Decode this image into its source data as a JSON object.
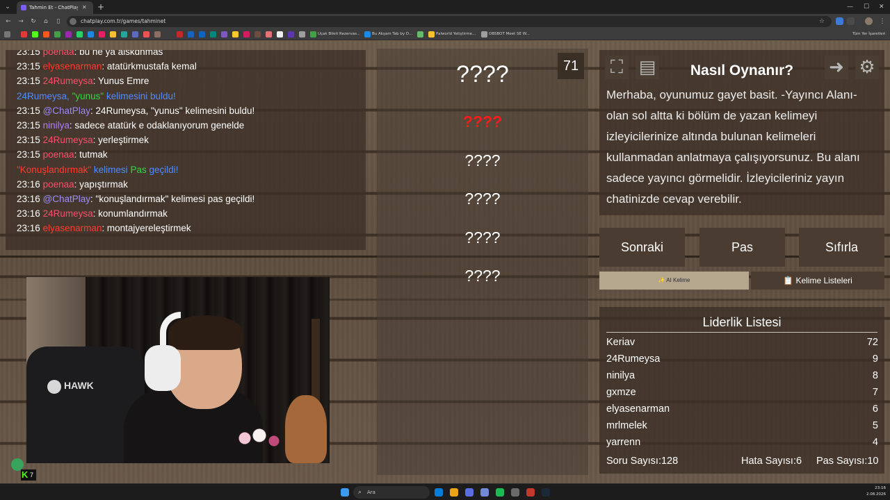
{
  "browser": {
    "tab_title": "Tahmin Et - ChatPlay",
    "url": "chatplay.com.tr/games/tahminet",
    "bookmarks": [
      "Uçak Bileti Rezervas...",
      "Bu Akşam Tab by D...",
      "Palworld Yetiştirme...",
      "OBSBOT Meet SE W..."
    ],
    "all_bookmarks_label": "Tüm Yer İşaretleri"
  },
  "chat": {
    "lines": [
      {
        "time": "23:15",
        "user": "poenaa",
        "color": "pink",
        "text": ": bu ne ya alskdnmas"
      },
      {
        "time": "23:15",
        "user": "elyasenarman",
        "color": "red",
        "text": ": atatürkmustafa kemal"
      },
      {
        "time": "23:15",
        "user": "24Rumeysa",
        "color": "pink",
        "text": ": Yunus Emre"
      },
      {
        "time": "23:15",
        "user": "@ChatPlay",
        "color": "violet",
        "text": ": 24Rumeysa, \"yunus\" kelimesini buldu!"
      },
      {
        "time": "23:15",
        "user": "ninilya",
        "color": "purple",
        "text": ": sadece atatürk e odaklanıyorum genelde"
      },
      {
        "time": "23:15",
        "user": "24Rumeysa",
        "color": "pink",
        "text": ": yerleştirmek"
      },
      {
        "time": "23:15",
        "user": "poenaa",
        "color": "pink",
        "text": ": tutmak"
      },
      {
        "time": "23:16",
        "user": "poenaa",
        "color": "pink",
        "text": ": yapıştırmak"
      },
      {
        "time": "23:16",
        "user": "@ChatPlay",
        "color": "violet",
        "text": ": \"konuşlandırmak\" kelimesi pas geçildi!"
      },
      {
        "time": "23:16",
        "user": "24Rumeysa",
        "color": "pink",
        "text": ": konumlandırmak"
      },
      {
        "time": "23:16",
        "user": "elyasenarman",
        "color": "red",
        "text": ": montajyereleştirmek"
      }
    ],
    "found_notice": {
      "user": "24Rumeysa",
      "word": "\"yunus\"",
      "rest": "kelimesini buldu!"
    },
    "pass_notice": {
      "word": "\"Konuşlandırmak\"",
      "mid": "kelimesi",
      "pas": "Pas",
      "end": "geçildi!"
    }
  },
  "stream": {
    "badge_text": "7"
  },
  "words": {
    "counter": "71",
    "main": "????",
    "highlighted": "????",
    "list": [
      "????",
      "????",
      "????",
      "????"
    ]
  },
  "info": {
    "title": "Nasıl Oynanır?",
    "text": "Merhaba, oyunumuz gayet basit. -Yayıncı Alanı- olan sol altta ki bölüm de yazan kelimeyi izleyicilerinize altında bulunan kelimeleri kullanmadan anlatmaya çalışıyorsunuz. Bu alanı sadece yayıncı görmelidir. İzleyicileriniz yayın chatinizde cevap verebilir."
  },
  "actions": {
    "next": "Sonraki",
    "pass": "Pas",
    "reset": "Sıfırla",
    "ai_word_tab": "✨ AI Kelime",
    "word_lists_tab": "📋 Kelime Listeleri"
  },
  "leaderboard": {
    "title": "Liderlik Listesi",
    "rows": [
      {
        "name": "Keriav",
        "score": "72"
      },
      {
        "name": "24Rumeysa",
        "score": "9"
      },
      {
        "name": "ninilya",
        "score": "8"
      },
      {
        "name": "gxmze",
        "score": "7"
      },
      {
        "name": "elyasenarman",
        "score": "6"
      },
      {
        "name": "mrlmelek",
        "score": "5"
      },
      {
        "name": "yarrenn",
        "score": "4"
      }
    ],
    "question_label": "Soru Sayısı:",
    "question_count": "128",
    "error_label": "Hata Sayısı:",
    "error_count": "6",
    "pass_label": "Pas Sayısı:",
    "pass_count": "10"
  },
  "taskbar": {
    "search_label": "Ara",
    "time": "23:16",
    "date": "2.08.2026"
  },
  "colors": {
    "user_pink": "#ff4d6d",
    "user_red": "#ff3b30",
    "user_purple": "#b27cff",
    "user_blue": "#4f8cff",
    "pass_green": "#31d843",
    "highlight_word": "#ff1a1a"
  }
}
